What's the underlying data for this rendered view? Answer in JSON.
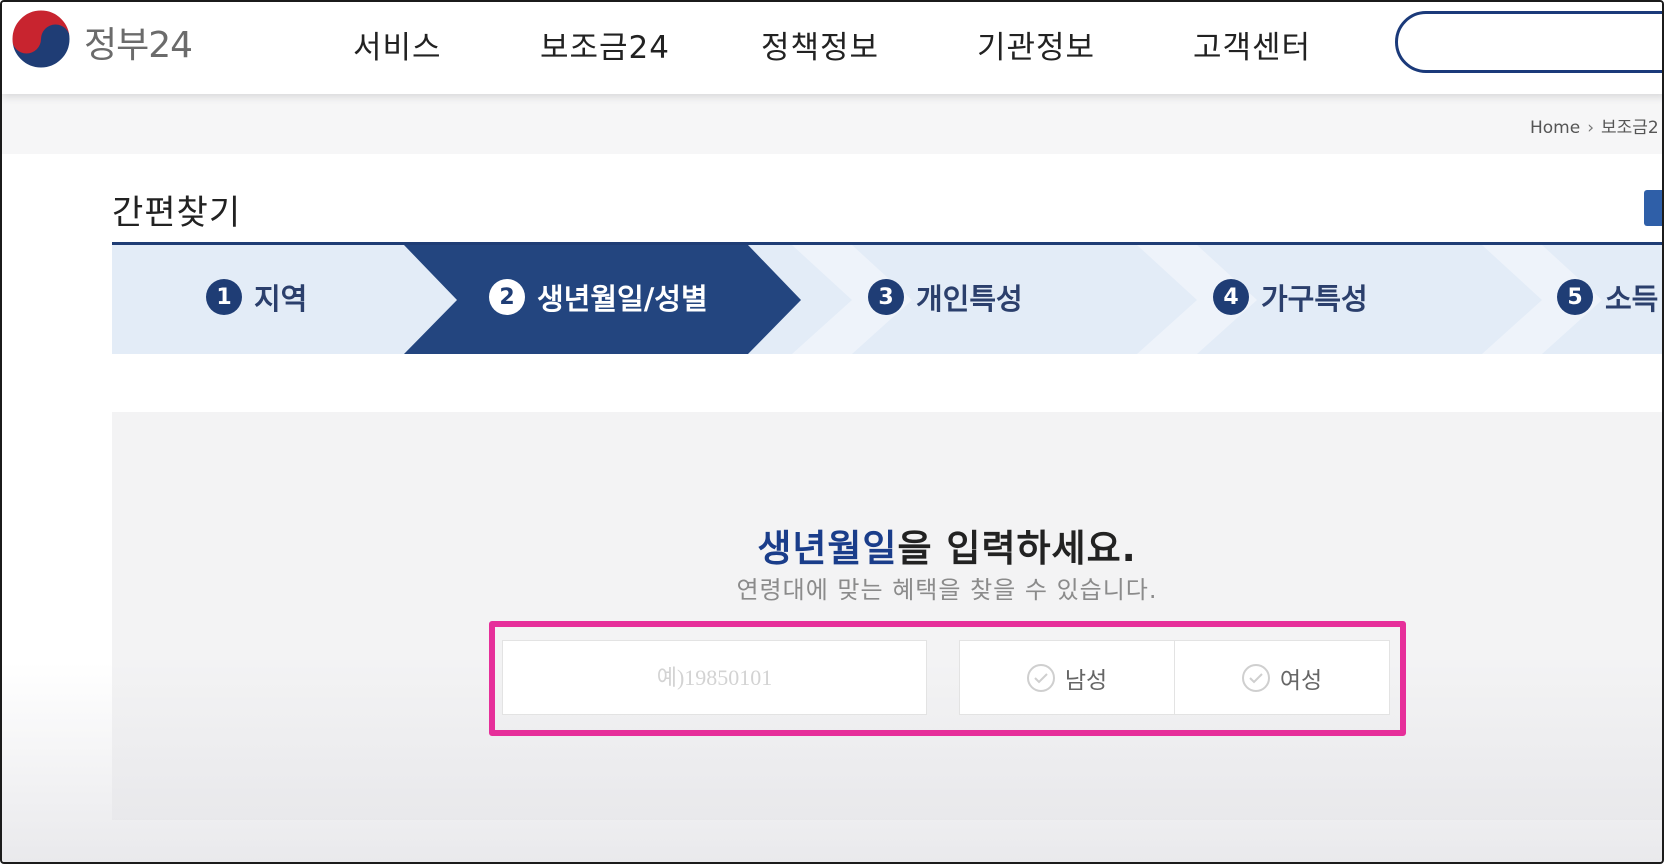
{
  "header": {
    "logo_text": "정부24",
    "nav": [
      "서비스",
      "보조금24",
      "정책정보",
      "기관정보",
      "고객센터"
    ]
  },
  "breadcrumb": {
    "home": "Home",
    "current": "보조금2"
  },
  "page": {
    "title": "간편찾기"
  },
  "steps": [
    {
      "num": "1",
      "label": "지역",
      "active": false
    },
    {
      "num": "2",
      "label": "생년월일/성별",
      "active": true
    },
    {
      "num": "3",
      "label": "개인특성",
      "active": false
    },
    {
      "num": "4",
      "label": "가구특성",
      "active": false
    },
    {
      "num": "5",
      "label": "소득",
      "active": false
    }
  ],
  "form": {
    "heading_accent": "생년월일",
    "heading_rest": "을 입력하세요.",
    "subtext": "연령대에 맞는 혜택을 찾을 수 있습니다.",
    "birth_placeholder": "예)19850101",
    "gender_male": "남성",
    "gender_female": "여성"
  },
  "colors": {
    "brand_navy": "#1f3d75",
    "step_light": "#e3ecf7",
    "accent_text": "#1a3d8a",
    "highlight": "#e62f9a"
  }
}
